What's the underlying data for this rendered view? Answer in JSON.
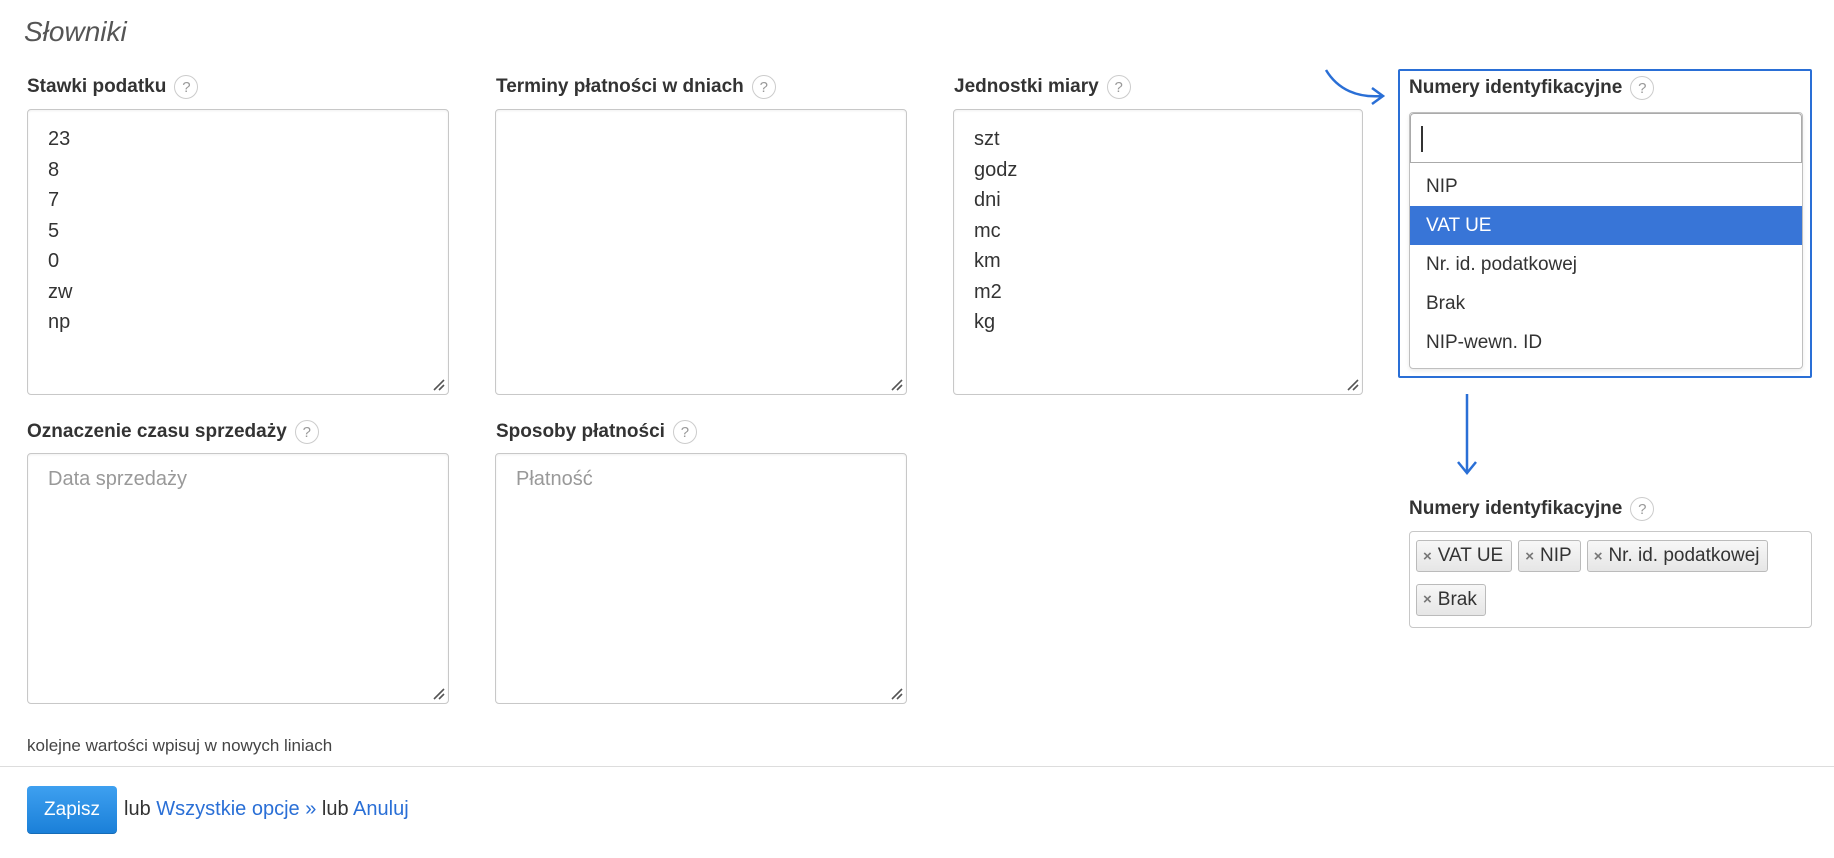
{
  "page": {
    "title": "Słowniki"
  },
  "fields": {
    "tax_rates": {
      "label": "Stawki podatku",
      "help": "?",
      "values": [
        "23",
        "8",
        "7",
        "5",
        "0",
        "zw",
        "np"
      ]
    },
    "payment_terms": {
      "label": "Terminy płatności w dniach",
      "help": "?"
    },
    "units": {
      "label": "Jednostki miary",
      "help": "?",
      "values": [
        "szt",
        "godz",
        "dni",
        "mc",
        "km",
        "m2",
        "kg"
      ]
    },
    "sale_date": {
      "label": "Oznaczenie czasu sprzedaży",
      "help": "?",
      "placeholder": "Data sprzedaży"
    },
    "payment_methods": {
      "label": "Sposoby płatności",
      "help": "?",
      "placeholder": "Płatność"
    }
  },
  "id_numbers_dropdown": {
    "label": "Numery identyfikacyjne",
    "help": "?",
    "search_value": "",
    "options": [
      "NIP",
      "VAT UE",
      "Nr. id. podatkowej",
      "Brak",
      "NIP-wewn. ID"
    ],
    "highlighted": "VAT UE"
  },
  "id_numbers_selected": {
    "label": "Numery identyfikacyjne",
    "help": "?",
    "tags": [
      "VAT UE",
      "NIP",
      "Nr. id. podatkowej",
      "Brak"
    ],
    "remove_glyph": "×"
  },
  "hint": "kolejne wartości wpisuj w nowych liniach",
  "footer": {
    "save_label": "Zapisz",
    "or_1": "lub",
    "all_options": "Wszystkie opcje »",
    "or_2": "lub",
    "cancel": "Anuluj"
  },
  "colors": {
    "accent": "#2a6fd6",
    "highlight": "#3875d7",
    "button": "#1a7fd8"
  }
}
